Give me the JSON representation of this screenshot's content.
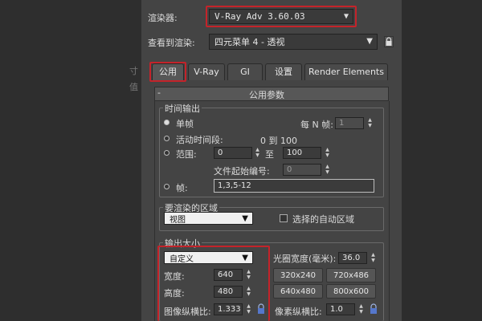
{
  "renderer": {
    "label": "渲染器:",
    "value": "V-Ray Adv 3.60.03"
  },
  "view_to_render": {
    "label": "查看到渲染:",
    "value": "四元菜单 4 - 透视"
  },
  "tabs": [
    "公用",
    "V-Ray",
    "GI",
    "设置",
    "Render Elements"
  ],
  "rollout": {
    "collapse": "-",
    "title": "公用参数"
  },
  "time_output": {
    "title": "时间输出",
    "single": "单帧",
    "every_n_label": "每 N 帧:",
    "every_n_value": "1",
    "active_segment": "活动时间段:",
    "active_range": "0 到 100",
    "range": "范围:",
    "range_from": "0",
    "range_to_label": "至",
    "range_to": "100",
    "file_start_label": "文件起始编号:",
    "file_start_value": "0",
    "frames": "帧:",
    "frames_value": "1,3,5-12"
  },
  "area": {
    "title": "要渲染的区域",
    "value": "视图",
    "auto_region": "选择的自动区域"
  },
  "output_size": {
    "title": "输出大小",
    "preset": "自定义",
    "aperture_label": "光圈宽度(毫米):",
    "aperture_value": "36.0",
    "width_label": "宽度:",
    "width_value": "640",
    "height_label": "高度:",
    "height_value": "480",
    "presets": [
      "320x240",
      "720x486",
      "640x480",
      "800x600"
    ],
    "image_aspect_label": "图像纵横比:",
    "image_aspect_value": "1.333",
    "pixel_aspect_label": "像素纵横比:",
    "pixel_aspect_value": "1.0"
  },
  "side_marks": [
    "寸",
    "值"
  ],
  "colors": {
    "highlight": "#c4232a",
    "panel": "#444444",
    "background": "#2b2b2b"
  }
}
